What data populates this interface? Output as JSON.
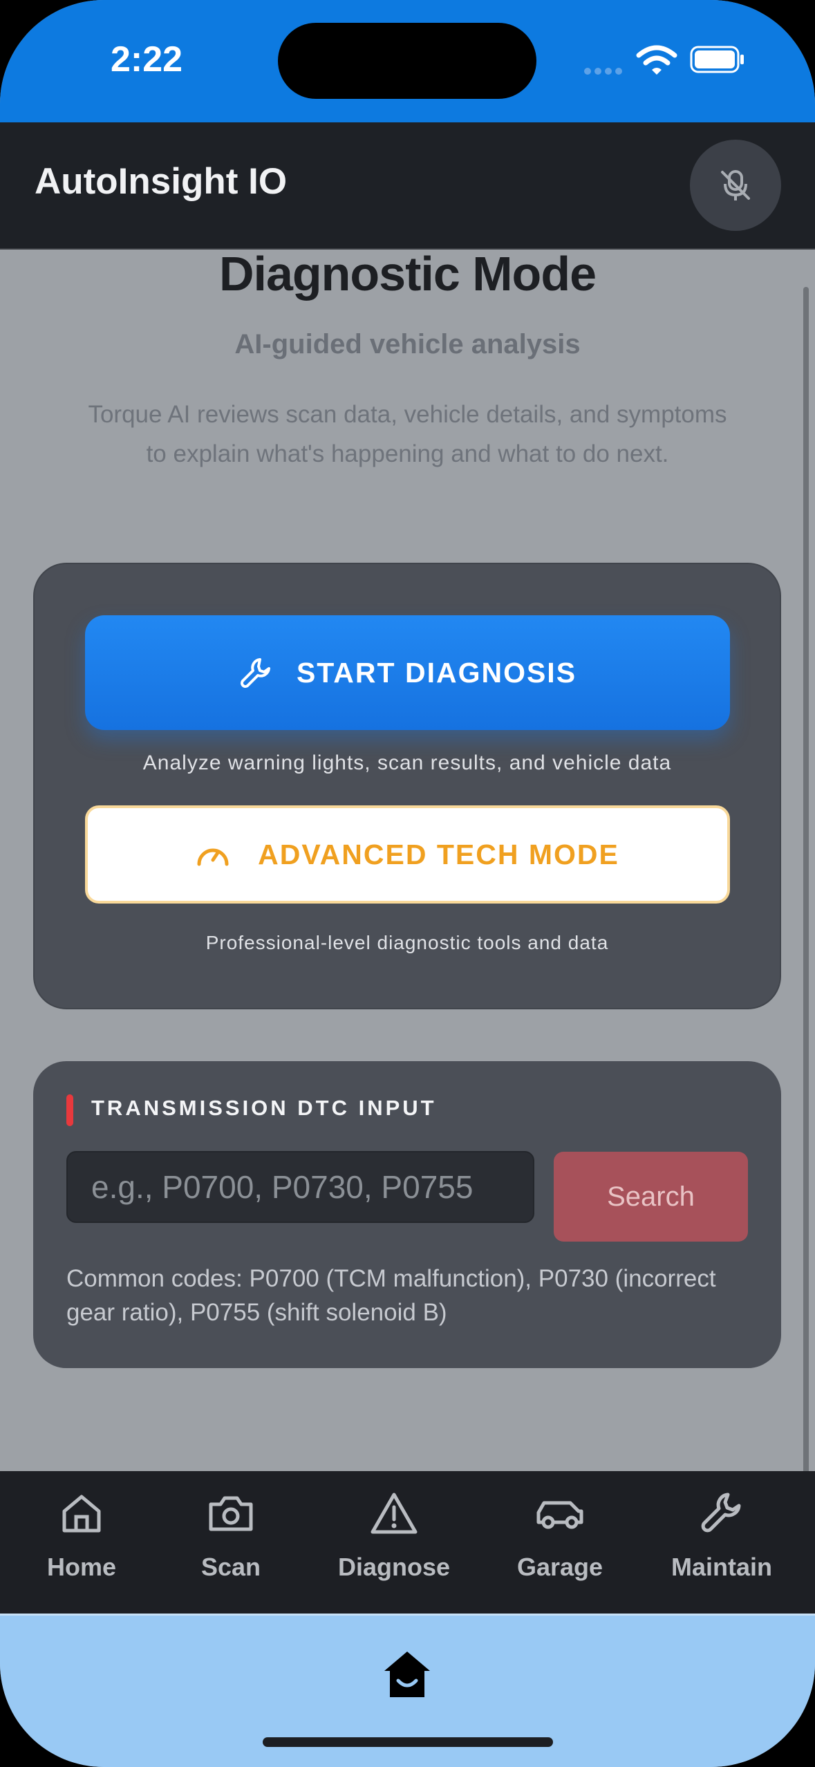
{
  "status_bar": {
    "time": "2:22"
  },
  "app_bar": {
    "title": "AutoInsight IO",
    "mic_icon": "mic-off-icon"
  },
  "header": {
    "title": "Diagnostic Mode",
    "subtitle": "AI-guided vehicle analysis",
    "description": "Torque AI reviews scan data, vehicle details, and symptoms to explain what's happening and what to do next."
  },
  "diagnosis_card": {
    "start_button": {
      "label": "START DIAGNOSIS",
      "icon": "wrench-icon"
    },
    "start_caption": "Analyze warning lights, scan results, and vehicle data",
    "advanced_button": {
      "label": "ADVANCED TECH MODE",
      "icon": "gauge-icon"
    },
    "advanced_caption": "Professional-level diagnostic tools and data"
  },
  "dtc_card": {
    "title": "TRANSMISSION DTC INPUT",
    "input": {
      "value": "",
      "placeholder": "e.g., P0700, P0730, P0755"
    },
    "search_label": "Search",
    "common_codes": "Common codes: P0700 (TCM malfunction), P0730 (incorrect gear ratio), P0755 (shift solenoid B)"
  },
  "tab_bar": {
    "tabs": [
      {
        "label": "Home",
        "icon": "home-icon"
      },
      {
        "label": "Scan",
        "icon": "camera-icon"
      },
      {
        "label": "Diagnose",
        "icon": "warning-icon"
      },
      {
        "label": "Garage",
        "icon": "car-icon"
      },
      {
        "label": "Maintain",
        "icon": "wrench-icon"
      }
    ]
  },
  "colors": {
    "status_bar": "#0d7ae0",
    "primary_button": "#1d7ff0",
    "advanced_accent": "#f0a020",
    "search_button": "#a7515a",
    "dtc_marker": "#e8393d"
  }
}
